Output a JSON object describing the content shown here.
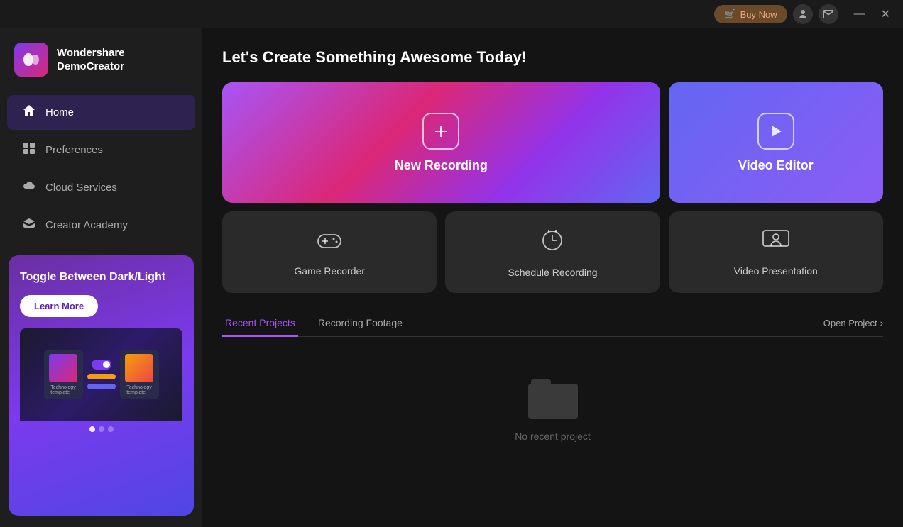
{
  "app": {
    "name": "Wondershare DemoCreator"
  },
  "titlebar": {
    "buy_now_label": "Buy Now",
    "minimize_label": "—",
    "close_label": "✕"
  },
  "sidebar": {
    "logo_text": "Wondershare\nDemoCreator",
    "nav_items": [
      {
        "id": "home",
        "label": "Home",
        "icon": "home",
        "active": true
      },
      {
        "id": "preferences",
        "label": "Preferences",
        "icon": "grid",
        "active": false
      },
      {
        "id": "cloud-services",
        "label": "Cloud Services",
        "icon": "cloud",
        "active": false
      },
      {
        "id": "creator-academy",
        "label": "Creator Academy",
        "icon": "graduation",
        "active": false
      }
    ],
    "promo": {
      "title": "Toggle Between Dark/Light",
      "learn_more_label": "Learn More"
    }
  },
  "main": {
    "heading": "Let's Create Something Awesome Today!",
    "cards": [
      {
        "id": "new-recording",
        "label": "New Recording",
        "icon": "plus"
      },
      {
        "id": "video-editor",
        "label": "Video Editor",
        "icon": "play"
      },
      {
        "id": "game-recorder",
        "label": "Game Recorder",
        "icon": "gamepad"
      },
      {
        "id": "schedule-recording",
        "label": "Schedule Recording",
        "icon": "clock"
      },
      {
        "id": "video-presentation",
        "label": "Video Presentation",
        "icon": "person-screen"
      }
    ],
    "tabs": [
      {
        "id": "recent-projects",
        "label": "Recent Projects",
        "active": true
      },
      {
        "id": "recording-footage",
        "label": "Recording Footage",
        "active": false
      }
    ],
    "open_project_label": "Open Project",
    "empty_state_text": "No recent project"
  }
}
